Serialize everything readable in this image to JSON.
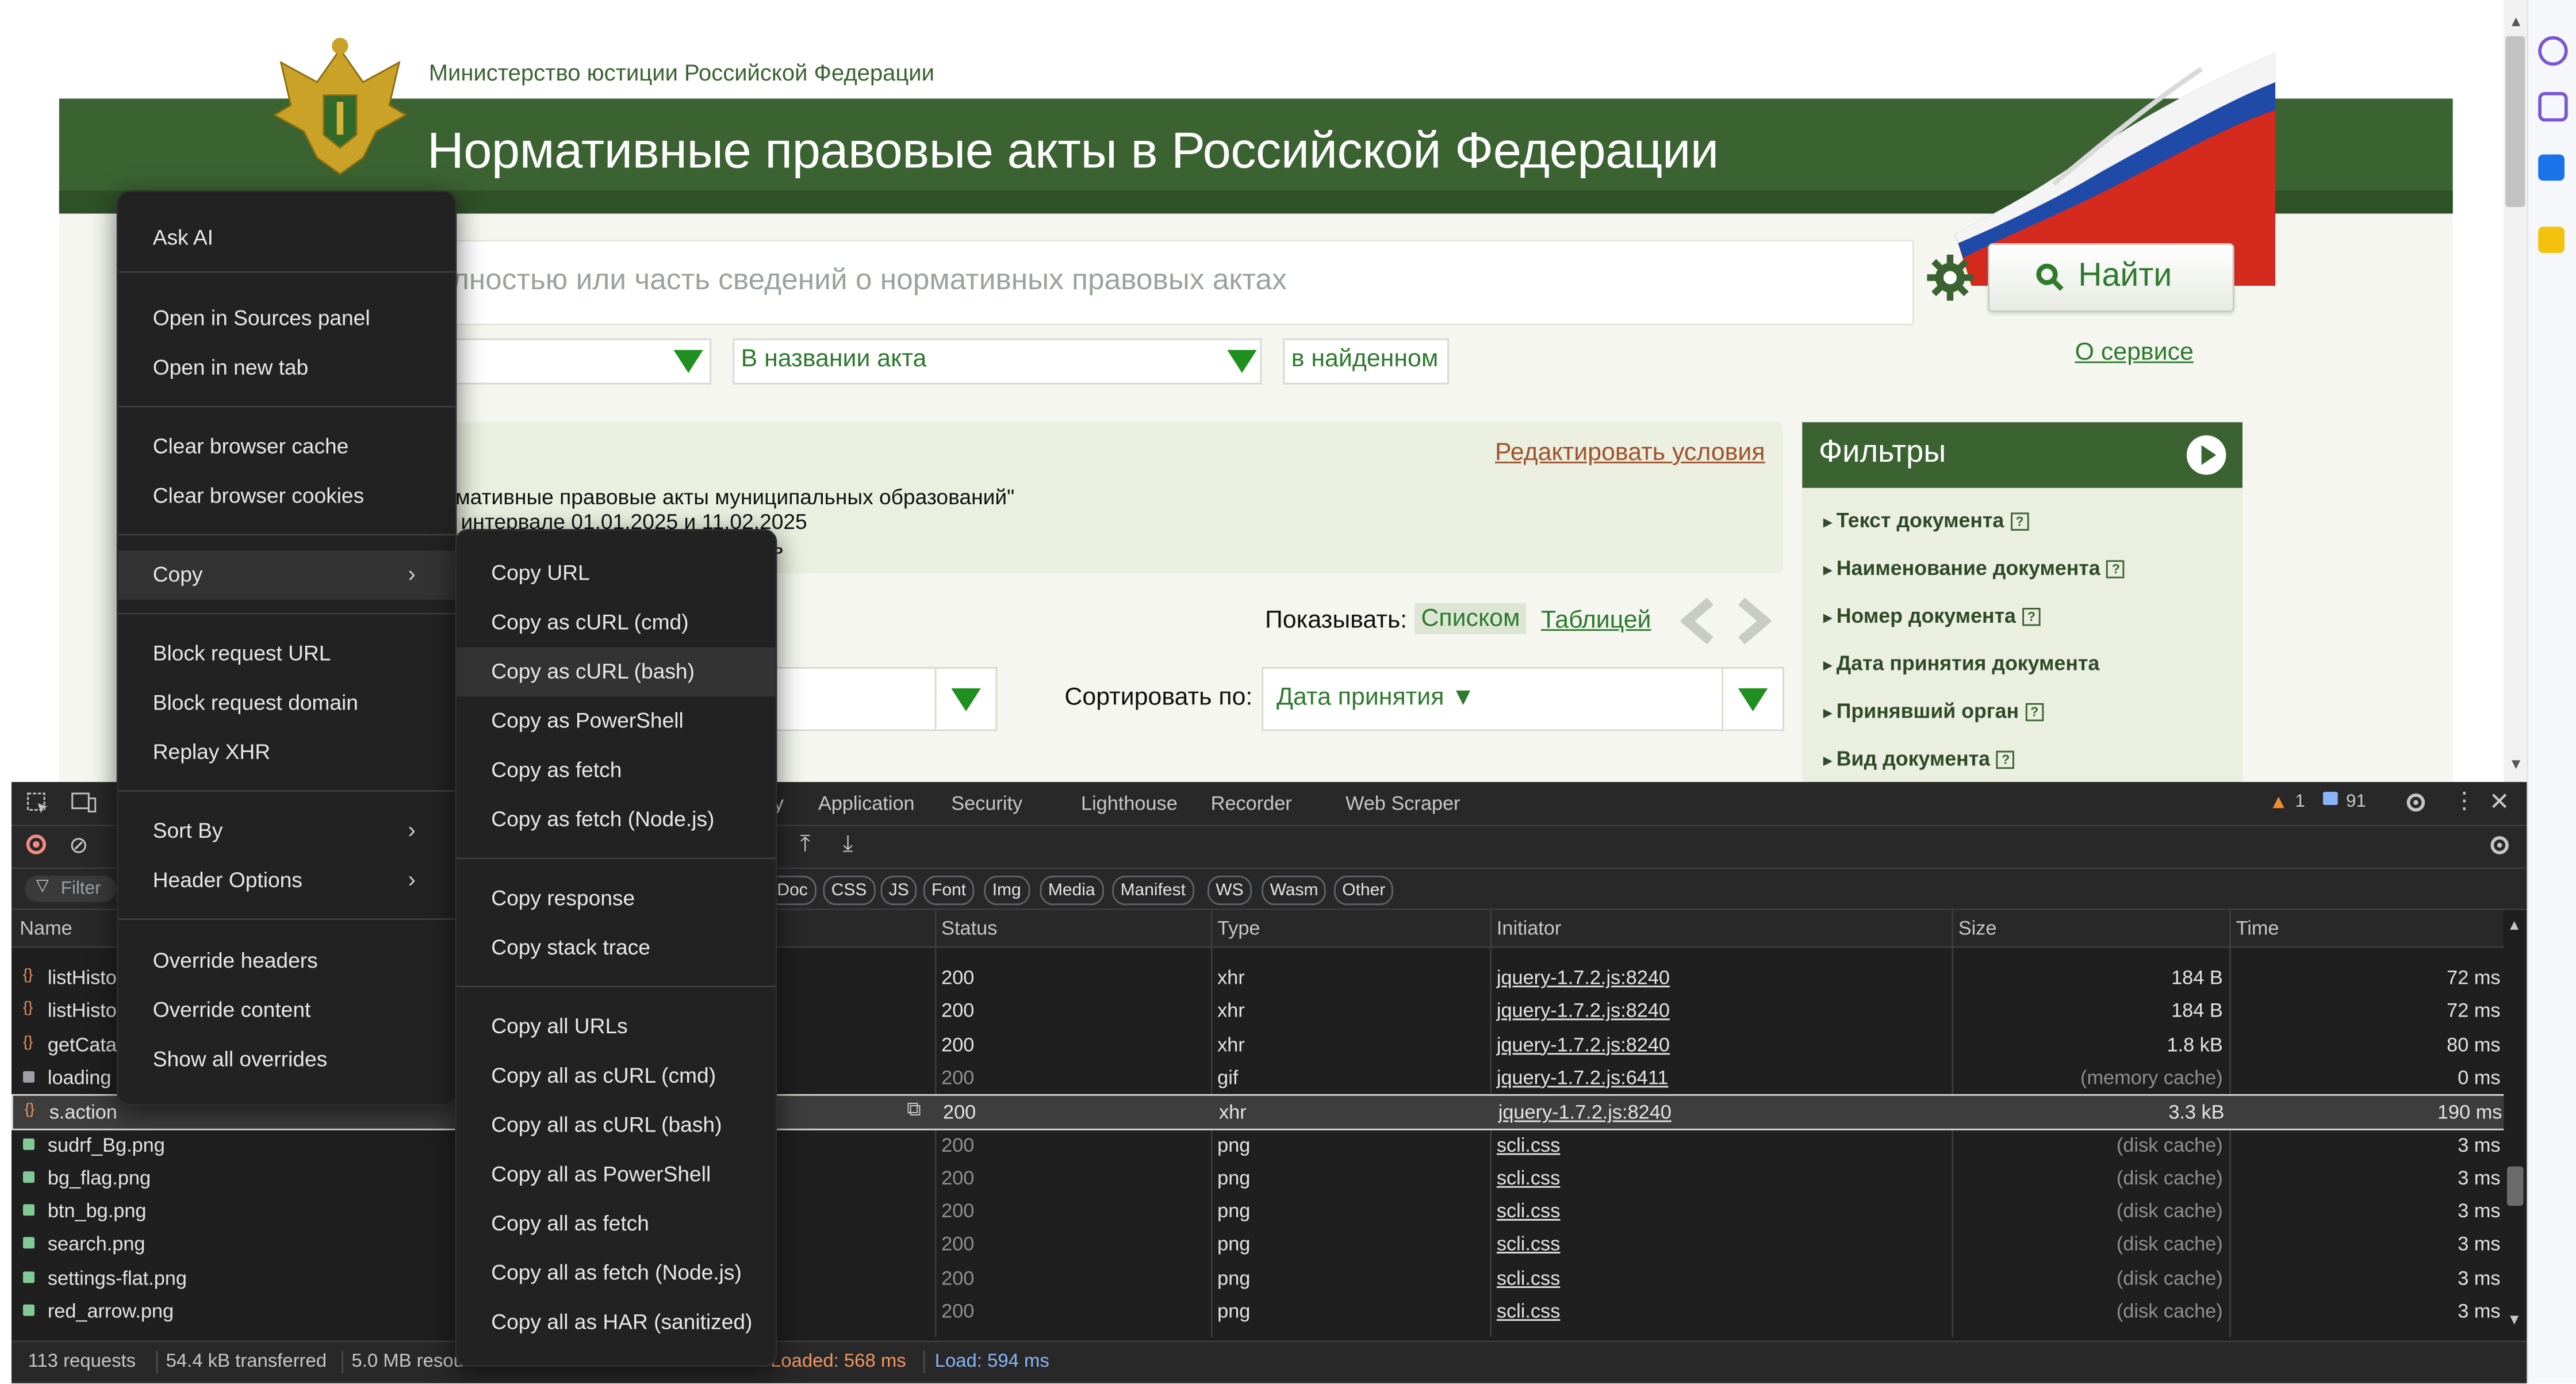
{
  "webpage": {
    "ministry": "Министерство юстиции Российской Федерации",
    "title": "Нормативные правовые акты в Российской Федерации",
    "search_placeholder": "лностью или часть сведений о нормативных правовых актах",
    "find_button": "Найти",
    "select_mid": "В названии акта",
    "select_right": "в найденном",
    "about_link": "О сервисе",
    "edit_conditions": "Редактировать условия",
    "condition_line1": "рмативные правовые акты муниципальных образований\"",
    "condition_line2": "в интервале 01.01.2025 и 11.02.2025",
    "condition_line3": "ь",
    "show_label": "Показывать:",
    "show_list": "Списком",
    "show_table": "Таблицей",
    "sort_label": "Сортировать по:",
    "sort_value": "Дата принятия ▼",
    "filters": {
      "title": "Фильтры",
      "items": [
        {
          "label": "Текст документа",
          "help": true
        },
        {
          "label": "Наименование документа",
          "help": true
        },
        {
          "label": "Номер документа",
          "help": true
        },
        {
          "label": "Дата принятия документа",
          "help": false
        },
        {
          "label": "Принявший орган",
          "help": true
        },
        {
          "label": "Вид документа",
          "help": true
        }
      ]
    }
  },
  "devtools": {
    "tabs": [
      "y",
      "Application",
      "Security",
      "Lighthouse",
      "Recorder",
      "Web Scraper"
    ],
    "warnings": "1",
    "messages": "91",
    "filter_placeholder": "Filter",
    "type_chips": [
      "Doc",
      "CSS",
      "JS",
      "Font",
      "Img",
      "Media",
      "Manifest",
      "WS",
      "Wasm",
      "Other"
    ],
    "columns": [
      "Name",
      "Status",
      "Type",
      "Initiator",
      "Size",
      "Time"
    ],
    "rows": [
      {
        "name": "listHisto",
        "status": "200",
        "type": "xhr",
        "initiator": "jquery-1.7.2.js:8240",
        "size": "184 B",
        "time": "72 ms",
        "dim": false,
        "icon": "xhr"
      },
      {
        "name": "listHisto",
        "status": "200",
        "type": "xhr",
        "initiator": "jquery-1.7.2.js:8240",
        "size": "184 B",
        "time": "72 ms",
        "dim": false,
        "icon": "xhr"
      },
      {
        "name": "getCatal",
        "status": "200",
        "type": "xhr",
        "initiator": "jquery-1.7.2.js:8240",
        "size": "1.8 kB",
        "time": "80 ms",
        "dim": false,
        "icon": "xhr"
      },
      {
        "name": "loading",
        "status": "200",
        "type": "gif",
        "initiator": "jquery-1.7.2.js:6411",
        "size": "(memory cache)",
        "time": "0 ms",
        "dim": true,
        "icon": "img"
      },
      {
        "name": "s.action",
        "status": "200",
        "type": "xhr",
        "initiator": "jquery-1.7.2.js:8240",
        "size": "3.3 kB",
        "time": "190 ms",
        "dim": false,
        "icon": "xhr",
        "selected": true
      },
      {
        "name": "sudrf_Bg.png",
        "status": "200",
        "type": "png",
        "initiator": "scli.css",
        "size": "(disk cache)",
        "time": "3 ms",
        "dim": true,
        "icon": "png"
      },
      {
        "name": "bg_flag.png",
        "status": "200",
        "type": "png",
        "initiator": "scli.css",
        "size": "(disk cache)",
        "time": "3 ms",
        "dim": true,
        "icon": "png"
      },
      {
        "name": "btn_bg.png",
        "status": "200",
        "type": "png",
        "initiator": "scli.css",
        "size": "(disk cache)",
        "time": "3 ms",
        "dim": true,
        "icon": "png"
      },
      {
        "name": "search.png",
        "status": "200",
        "type": "png",
        "initiator": "scli.css",
        "size": "(disk cache)",
        "time": "3 ms",
        "dim": true,
        "icon": "png"
      },
      {
        "name": "settings-flat.png",
        "status": "200",
        "type": "png",
        "initiator": "scli.css",
        "size": "(disk cache)",
        "time": "3 ms",
        "dim": true,
        "icon": "png"
      },
      {
        "name": "red_arrow.png",
        "status": "200",
        "type": "png",
        "initiator": "scli.css",
        "size": "(disk cache)",
        "time": "3 ms",
        "dim": true,
        "icon": "png"
      }
    ],
    "status_bar": {
      "requests": "113 requests",
      "transferred": "54.4 kB transferred",
      "resources": "5.0 MB resou",
      "dom_loaded": "Loaded: 568 ms",
      "load": "Load: 594 ms"
    }
  },
  "context_menu": {
    "items": [
      "Ask AI",
      "Open in Sources panel",
      "Open in new tab",
      "Clear browser cache",
      "Clear browser cookies",
      "Copy",
      "Block request URL",
      "Block request domain",
      "Replay XHR",
      "Sort By",
      "Header Options",
      "Override headers",
      "Override content",
      "Show all overrides"
    ]
  },
  "copy_submenu": {
    "items": [
      "Copy URL",
      "Copy as cURL (cmd)",
      "Copy as cURL (bash)",
      "Copy as PowerShell",
      "Copy as fetch",
      "Copy as fetch (Node.js)",
      "Copy response",
      "Copy stack trace",
      "Copy all URLs",
      "Copy all as cURL (cmd)",
      "Copy all as cURL (bash)",
      "Copy all as PowerShell",
      "Copy all as fetch",
      "Copy all as fetch (Node.js)",
      "Copy all as HAR (sanitized)"
    ],
    "highlighted": "Copy as cURL (bash)"
  },
  "colors": {
    "header_green": "#3b6332",
    "link_green": "#2e7a2e",
    "devtools_bg": "#1f1f1f",
    "menu_bg": "#222222"
  }
}
